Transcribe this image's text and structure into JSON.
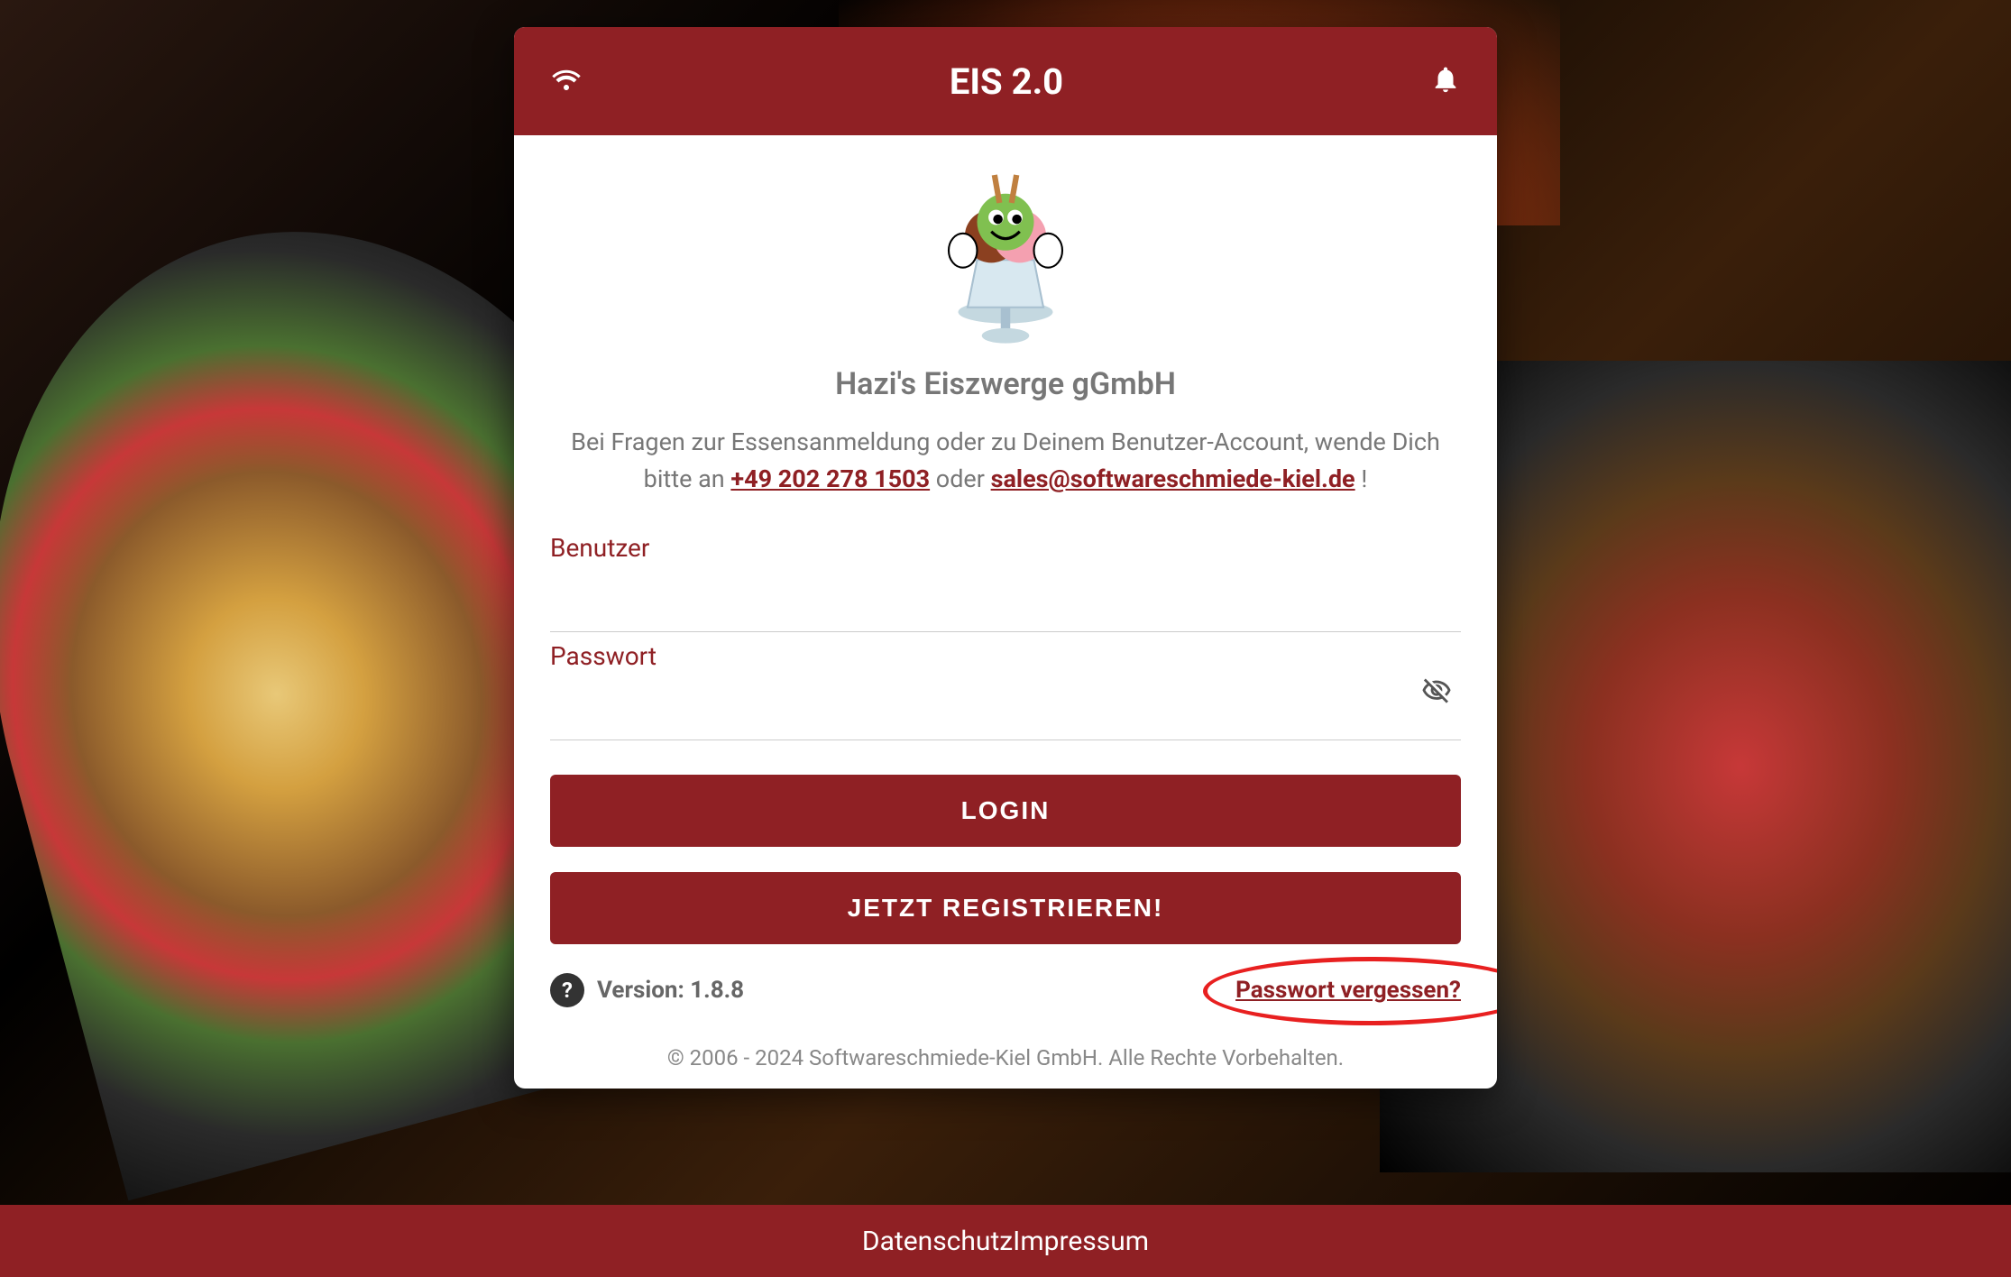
{
  "header": {
    "title": "EIS 2.0"
  },
  "company": {
    "name": "Hazi's Eiszwerge gGmbH"
  },
  "help": {
    "text_before": "Bei Fragen zur Essensanmeldung oder zu Deinem Benutzer-Account, wende Dich bitte an ",
    "phone": "+49 202 278 1503",
    "text_middle": " oder ",
    "email": "sales@softwareschmiede-kiel.de",
    "text_after": " !"
  },
  "form": {
    "username_label": "Benutzer",
    "password_label": "Passwort",
    "login_button": "LOGIN",
    "register_button": "JETZT REGISTRIEREN!"
  },
  "version": {
    "label": "Version: 1.8.8"
  },
  "links": {
    "forgot_password": "Passwort vergessen?"
  },
  "copyright": "© 2006 - 2024 Softwareschmiede-Kiel GmbH. Alle Rechte Vorbehalten.",
  "footer": {
    "privacy": "Datenschutz",
    "imprint": "Impressum"
  }
}
